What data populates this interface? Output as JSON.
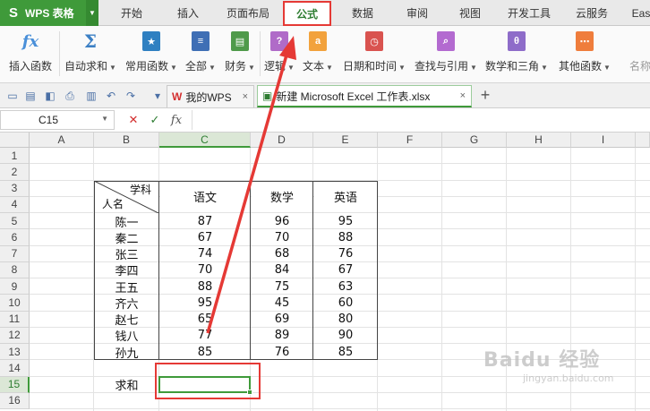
{
  "app": {
    "title": "WPS 表格"
  },
  "menu": {
    "tabs": [
      {
        "label": "开始"
      },
      {
        "label": "插入"
      },
      {
        "label": "页面布局"
      },
      {
        "label": "公式"
      },
      {
        "label": "数据"
      },
      {
        "label": "审阅"
      },
      {
        "label": "视图"
      },
      {
        "label": "开发工具"
      },
      {
        "label": "云服务"
      },
      {
        "label": "Eas"
      }
    ],
    "active_tab": "公式"
  },
  "ribbon": {
    "buttons": [
      {
        "label": "插入函数",
        "icon": "fx-icon",
        "color": "#4a90d9",
        "has_dropdown": false
      },
      {
        "label": "自动求和",
        "icon": "sigma-icon",
        "color": "#3b7fc4",
        "has_dropdown": true
      },
      {
        "label": "常用函数",
        "icon": "star-icon",
        "color": "#2f80c1",
        "has_dropdown": true
      },
      {
        "label": "全部",
        "icon": "book-icon",
        "color": "#3f6fb5",
        "has_dropdown": true
      },
      {
        "label": "财务",
        "icon": "finance-icon",
        "color": "#4f9a4a",
        "has_dropdown": true
      },
      {
        "label": "逻辑",
        "icon": "question-icon",
        "color": "#b06bc8",
        "has_dropdown": true
      },
      {
        "label": "文本",
        "icon": "text-a-icon",
        "color": "#f2a23c",
        "has_dropdown": true
      },
      {
        "label": "日期和时间",
        "icon": "clock-icon",
        "color": "#d9534f",
        "has_dropdown": true
      },
      {
        "label": "查找与引用",
        "icon": "search-icon",
        "color": "#b36ad0",
        "has_dropdown": true
      },
      {
        "label": "数学和三角",
        "icon": "theta-icon",
        "color": "#8e6cc9",
        "has_dropdown": true
      },
      {
        "label": "其他函数",
        "icon": "grid-icon",
        "color": "#ef7d3c",
        "has_dropdown": true
      },
      {
        "label": "名称",
        "icon": "name-icon",
        "color": "#9e9e9e",
        "has_dropdown": false
      }
    ]
  },
  "doc_tabs": [
    {
      "label": "我的WPS",
      "icon": "wps-icon",
      "icon_char": "W",
      "icon_color": "#d32f2f",
      "close": "×"
    },
    {
      "label": "新建 Microsoft Excel 工作表.xlsx",
      "icon": "sheet-icon",
      "icon_char": "▣",
      "icon_color": "#2e7d32",
      "close": "×",
      "active": true
    }
  ],
  "quick_access": [
    {
      "icon": "folder-icon",
      "char": "▭"
    },
    {
      "icon": "save-icon",
      "char": "▤"
    },
    {
      "icon": "print-preview-icon",
      "char": "◧"
    },
    {
      "icon": "print-icon",
      "char": "⎙"
    },
    {
      "icon": "export-icon",
      "char": "▥"
    },
    {
      "icon": "undo-icon",
      "char": "↶"
    },
    {
      "icon": "redo-icon",
      "char": "↷"
    },
    {
      "icon": "more-icon",
      "char": "▾"
    }
  ],
  "formula_bar": {
    "cell_ref": "C15",
    "cancel": "✕",
    "confirm": "✓",
    "fx": "fx",
    "formula": ""
  },
  "sheet": {
    "columns": [
      "A",
      "B",
      "C",
      "D",
      "E",
      "F",
      "G",
      "H",
      "I"
    ],
    "rows": [
      "1",
      "2",
      "3",
      "4",
      "5",
      "6",
      "7",
      "8",
      "9",
      "10",
      "11",
      "12",
      "13",
      "14",
      "15",
      "16"
    ],
    "selected_cell": "C15",
    "header": {
      "diag_top": "学科",
      "diag_bottom": "人名",
      "subjects": [
        "语文",
        "数学",
        "英语"
      ]
    },
    "records": [
      {
        "name": "陈一",
        "chinese": "87",
        "math": "96",
        "english": "95"
      },
      {
        "name": "秦二",
        "chinese": "67",
        "math": "70",
        "english": "88"
      },
      {
        "name": "张三",
        "chinese": "74",
        "math": "68",
        "english": "76"
      },
      {
        "name": "李四",
        "chinese": "70",
        "math": "84",
        "english": "67"
      },
      {
        "name": "王五",
        "chinese": "88",
        "math": "75",
        "english": "63"
      },
      {
        "name": "齐六",
        "chinese": "95",
        "math": "45",
        "english": "60"
      },
      {
        "name": "赵七",
        "chinese": "65",
        "math": "69",
        "english": "80"
      },
      {
        "name": "钱八",
        "chinese": "77",
        "math": "89",
        "english": "90"
      },
      {
        "name": "孙九",
        "chinese": "85",
        "math": "76",
        "english": "85"
      }
    ],
    "sum_label": "求和"
  },
  "annotation": {
    "color": "#e53935"
  },
  "watermark": {
    "brand": "Baidu 经验",
    "sub": "jingyan.baidu.com"
  }
}
